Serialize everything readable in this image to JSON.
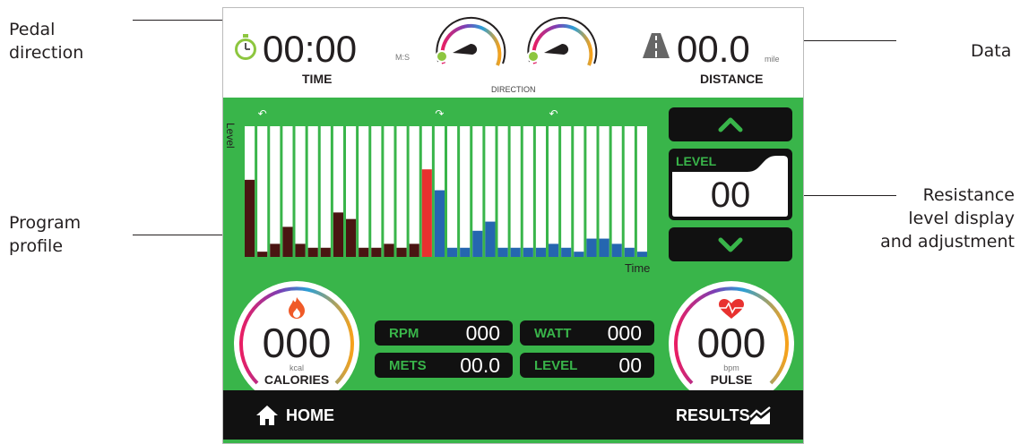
{
  "callouts": {
    "pedal_direction": [
      "Pedal",
      "direction"
    ],
    "data": "Data",
    "program_profile": [
      "Program",
      "profile"
    ],
    "resistance": [
      "Resistance",
      "level display",
      "and adjustment"
    ]
  },
  "header": {
    "time_value": "00:00",
    "time_unit": "M:S",
    "time_label": "TIME",
    "direction_label": "DIRECTION",
    "distance_value": "00.0",
    "distance_unit": "mile",
    "distance_label": "DISTANCE"
  },
  "profile": {
    "y_label": "Level",
    "x_label": "Time",
    "direction_marks": [
      "↶",
      "↷",
      "↶"
    ],
    "bar_levels": [
      0.59,
      0.04,
      0.1,
      0.23,
      0.1,
      0.07,
      0.07,
      0.34,
      0.29,
      0.07,
      0.07,
      0.1,
      0.07,
      0.1,
      0.67,
      0.51,
      0.07,
      0.07,
      0.2,
      0.27,
      0.07,
      0.07,
      0.07,
      0.07,
      0.1,
      0.07,
      0.04,
      0.14,
      0.14,
      0.1,
      0.07,
      0.04
    ],
    "bar_colors": [
      "#4a1512",
      "#4a1512",
      "#4a1512",
      "#4a1512",
      "#4a1512",
      "#4a1512",
      "#4a1512",
      "#4a1512",
      "#4a1512",
      "#4a1512",
      "#4a1512",
      "#4a1512",
      "#4a1512",
      "#4a1512",
      "#e8312f",
      "#2566b0",
      "#2566b0",
      "#2566b0",
      "#2566b0",
      "#2566b0",
      "#2566b0",
      "#2566b0",
      "#2566b0",
      "#2566b0",
      "#2566b0",
      "#2566b0",
      "#2566b0",
      "#2566b0",
      "#2566b0",
      "#2566b0",
      "#2566b0",
      "#2566b0"
    ]
  },
  "level_panel": {
    "up_icon": "chevron-up-icon",
    "label": "LEVEL",
    "value": "00",
    "down_icon": "chevron-down-icon"
  },
  "metrics": {
    "calories": {
      "value": "000",
      "unit": "kcal",
      "label": "CALORIES"
    },
    "pulse": {
      "value": "000",
      "unit": "bpm",
      "label": "PULSE"
    },
    "rpm": {
      "label": "RPM",
      "value": "000"
    },
    "watt": {
      "label": "WATT",
      "value": "000"
    },
    "mets": {
      "label": "METS",
      "value": "00.0"
    },
    "level": {
      "label": "LEVEL",
      "value": "00"
    }
  },
  "footer": {
    "home_label": "HOME",
    "results_label": "RESULTS"
  },
  "colors": {
    "green": "#39b54a",
    "dark": "#111111",
    "bar_past": "#4a1512",
    "bar_current": "#e8312f",
    "bar_future": "#2566b0"
  }
}
